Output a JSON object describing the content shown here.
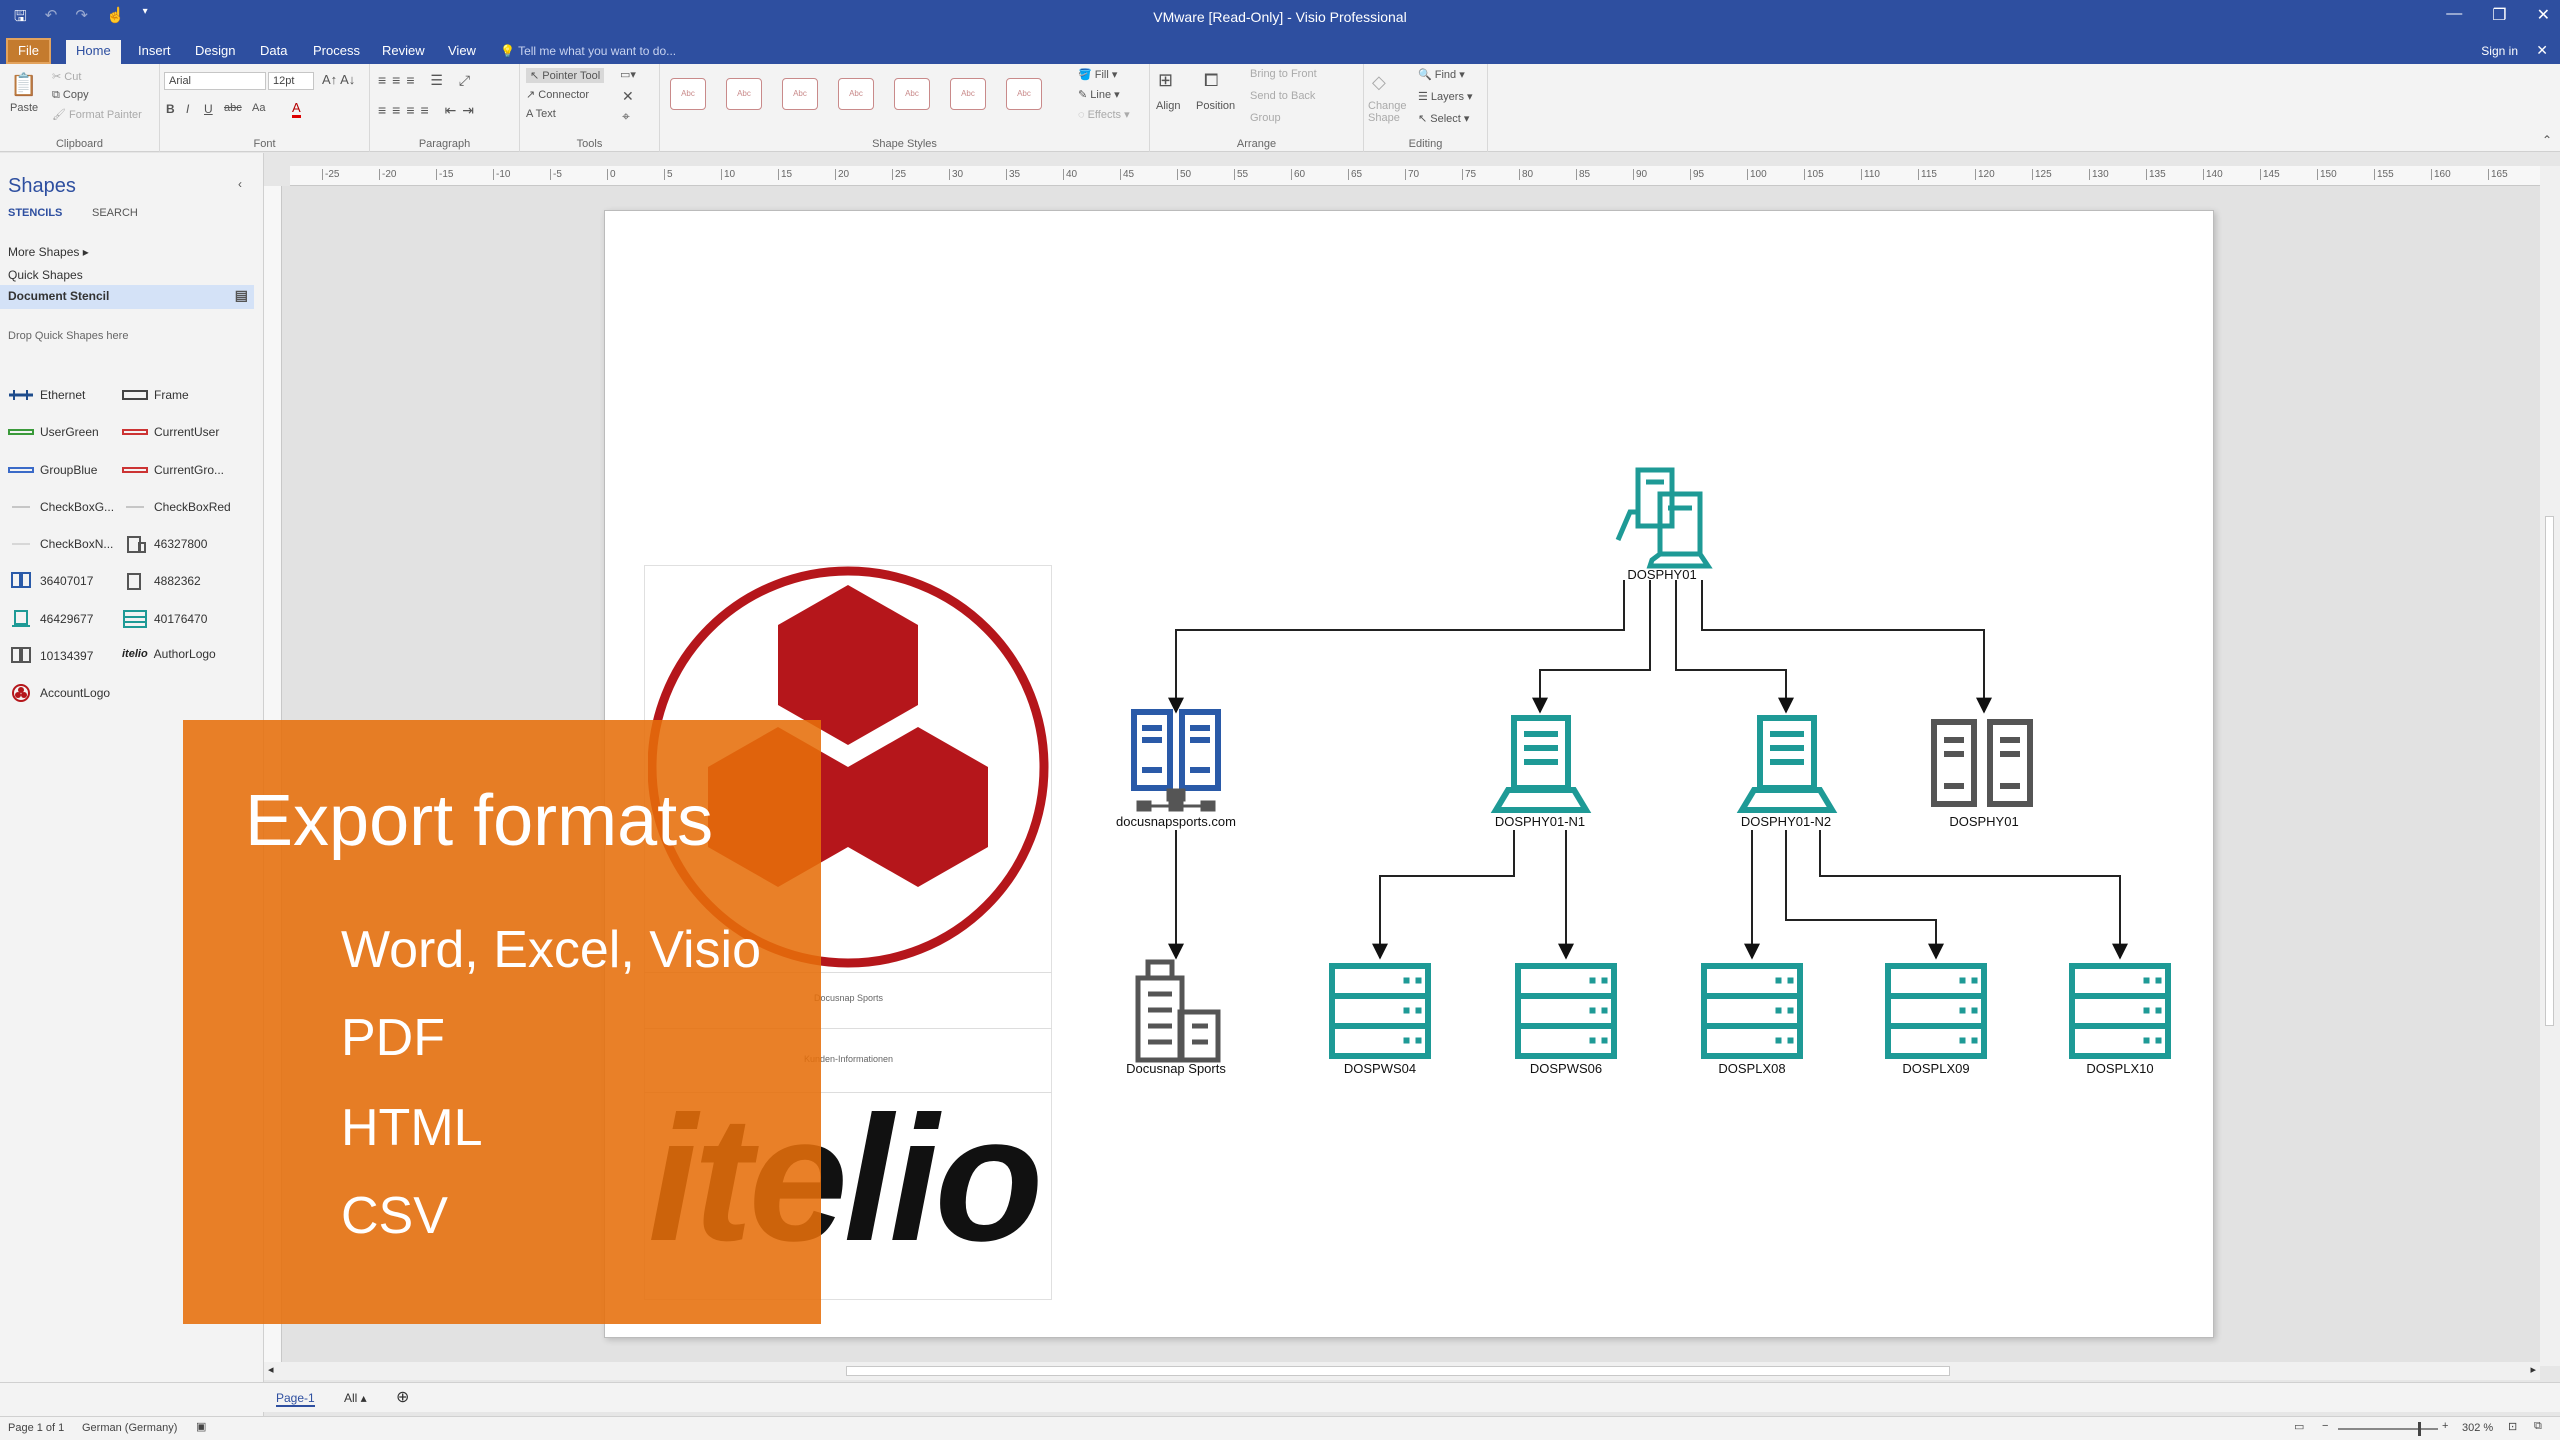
{
  "window": {
    "title": "VMware  [Read-Only] - Visio Professional",
    "sign_in": "Sign in"
  },
  "tabs": [
    "File",
    "Home",
    "Insert",
    "Design",
    "Data",
    "Process",
    "Review",
    "View"
  ],
  "tell_me": "Tell me what you want to do...",
  "ribbon": {
    "clipboard": {
      "paste": "Paste",
      "cut": "Cut",
      "copy": "Copy",
      "format_painter": "Format Painter",
      "label": "Clipboard"
    },
    "font": {
      "family": "Arial",
      "size": "12pt",
      "label": "Font"
    },
    "paragraph": {
      "label": "Paragraph"
    },
    "tools": {
      "pointer": "Pointer Tool",
      "connector": "Connector",
      "text": "Text",
      "label": "Tools"
    },
    "shape_styles": {
      "label": "Shape Styles",
      "fill": "Fill",
      "line": "Line",
      "effects": "Effects",
      "style_text": "Abc"
    },
    "arrange": {
      "align": "Align",
      "position": "Position",
      "bring_front": "Bring to Front",
      "send_back": "Send to Back",
      "group": "Group",
      "label": "Arrange"
    },
    "editing": {
      "change_shape": "Change Shape",
      "find": "Find",
      "layers": "Layers",
      "select": "Select",
      "label": "Editing"
    }
  },
  "shapes_pane": {
    "title": "Shapes",
    "tab_stencils": "STENCILS",
    "tab_search": "SEARCH",
    "more_shapes": "More Shapes",
    "quick_shapes": "Quick Shapes",
    "document_stencil": "Document Stencil",
    "drop_hint": "Drop Quick Shapes here",
    "stencils": [
      "Ethernet",
      "Frame",
      "UserGreen",
      "CurrentUser",
      "GroupBlue",
      "CurrentGro...",
      "CheckBoxG...",
      "CheckBoxRed",
      "CheckBoxN...",
      "46327800",
      "36407017",
      "4882362",
      "46429677",
      "40176470",
      "10134397",
      "AuthorLogo",
      "AccountLogo"
    ],
    "author_logo_text": "itelio"
  },
  "ruler_ticks": [
    "-25",
    "-20",
    "-15",
    "-10",
    "-5",
    "0",
    "5",
    "10",
    "15",
    "20",
    "25",
    "30",
    "35",
    "40",
    "45",
    "50",
    "55",
    "60",
    "65",
    "70",
    "75",
    "80",
    "85",
    "90",
    "95",
    "100",
    "105",
    "110",
    "115",
    "120",
    "125",
    "130",
    "135",
    "140",
    "145",
    "150",
    "155",
    "160",
    "165"
  ],
  "document": {
    "logo_text": "itelio",
    "line1": "Docusnap Sports",
    "line2": "Kunden-Informationen"
  },
  "overlay": {
    "heading": "Export formats",
    "formats": [
      "Word, Excel, Visio",
      "PDF",
      "HTML",
      "CSV"
    ]
  },
  "diagram": {
    "colors": {
      "teal": "#1e9a96",
      "blue": "#2a5aa8",
      "gray": "#555555",
      "red": "#b5161b"
    },
    "root": "DOSPHY01",
    "level1": [
      "docusnapsports.com",
      "DOSPHY01-N1",
      "DOSPHY01-N2",
      "DOSPHY01"
    ],
    "level2": [
      "Docusnap Sports",
      "DOSPWS04",
      "DOSPWS06",
      "DOSPLX08",
      "DOSPLX09",
      "DOSPLX10"
    ]
  },
  "page_tabs": {
    "page": "Page-1",
    "all": "All"
  },
  "status": {
    "page_of": "Page 1 of 1",
    "language": "German (Germany)",
    "zoom": "302 %"
  }
}
